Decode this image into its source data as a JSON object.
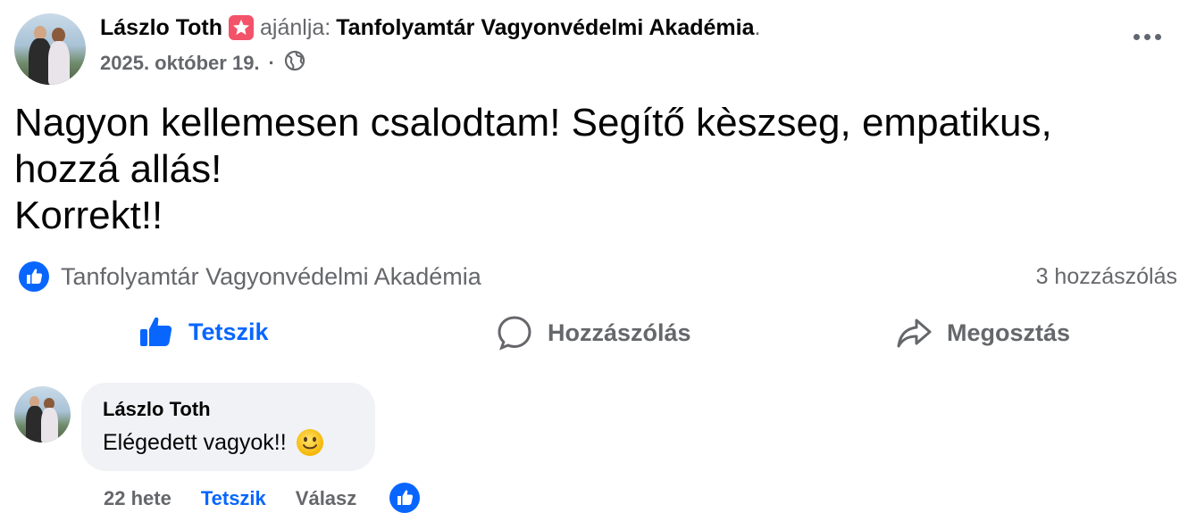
{
  "post": {
    "author": "Lászlo Toth",
    "verb": "ajánlja:",
    "page_name": "Tanfolyamtár Vagyonvédelmi Akadémia",
    "page_name_suffix": ".",
    "date": "2025. október 19.",
    "date_separator": "·",
    "text_lines": [
      "Nagyon kellemesen csalodtam! Segítő kèszseg, empatikus,",
      "hozzá allás!",
      "Korrekt!!"
    ],
    "reactions_label": "Tanfolyamtár Vagyonvédelmi Akadémia",
    "comments_count": "3 hozzászólás"
  },
  "actions": {
    "like": "Tetszik",
    "comment": "Hozzászólás",
    "share": "Megosztás"
  },
  "comment": {
    "author": "Lászlo Toth",
    "text": "Elégedett vagyok!!",
    "time": "22 hete",
    "like": "Tetszik",
    "reply": "Válasz"
  },
  "icons": {
    "recommend_badge": "star-badge-icon",
    "audience": "globe-icon",
    "more": "more-options-icon",
    "reaction": "like-reaction-icon",
    "like": "thumbs-up-icon",
    "comment": "speech-bubble-icon",
    "share": "share-arrow-icon",
    "emoji": "smiling-face-emoji"
  },
  "colors": {
    "accent": "#0866ff",
    "secondary_text": "#65676b",
    "primary_text": "#050505",
    "comment_bubble": "#f0f2f5",
    "badge": "#f35369"
  }
}
